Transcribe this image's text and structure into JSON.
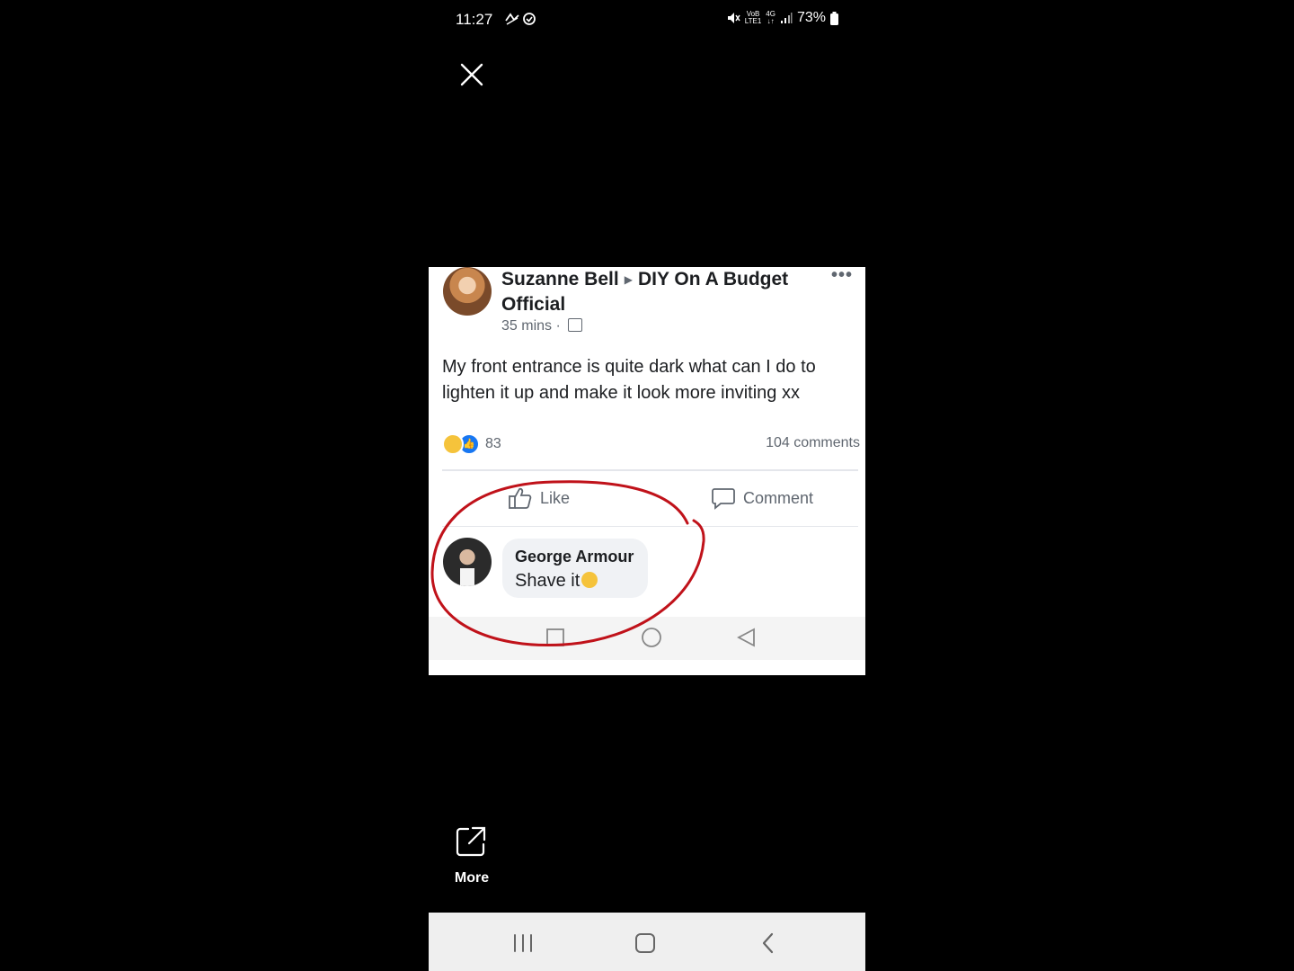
{
  "status_bar": {
    "time": "11:27",
    "battery_pct": "73%",
    "net_top": "VoB",
    "net_bottom": "LTE1",
    "net_type_top": "4G"
  },
  "post": {
    "author": "Suzanne Bell",
    "group": "DIY On A Budget Official",
    "time": "35 mins",
    "text": "My front entrance is quite dark what can I do to lighten it up and make it look more inviting xx",
    "reaction_count": "83",
    "comment_count": "104 comments",
    "like_label": "Like",
    "comment_label": "Comment"
  },
  "comment": {
    "author": "George Armour",
    "text": "Shave it"
  },
  "viewer": {
    "more_label": "More"
  },
  "colors": {
    "annotation_circle": "#c0121a",
    "facebook_blue": "#1877f2",
    "background": "#000000"
  }
}
